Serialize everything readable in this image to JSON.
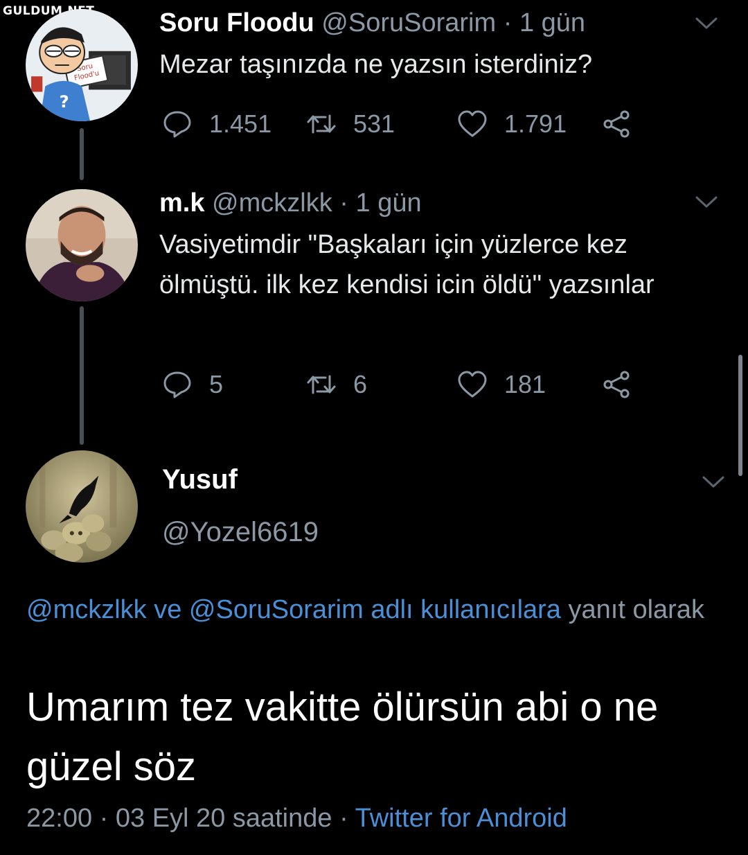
{
  "watermark": "GULDUM.NET",
  "tweets": [
    {
      "name": "Soru Floodu",
      "handle": "@SoruSorarim",
      "separator": "·",
      "time": "1 gün",
      "text": "Mezar taşınızda ne yazsın isterdiniz?",
      "replies": "1.451",
      "retweets": "531",
      "likes": "1.791",
      "avatar_text": "Soru Flood'u"
    },
    {
      "name": "m.k",
      "handle": "@mckzlkk",
      "separator": "·",
      "time": "1 gün",
      "text": "Vasiyetimdir \"Başkaları için yüzlerce kez ölmüştü. ilk kez kendisi icin öldü\" yazsınlar",
      "replies": "5",
      "retweets": "6",
      "likes": "181"
    }
  ],
  "focused_tweet": {
    "name": "Yusuf",
    "handle": "@Yozel6619",
    "reply_to": {
      "link_text": "@mckzlkk ve @SoruSorarim adlı kullanıcılara",
      "suffix": "yanıt olarak"
    },
    "text": "Umarım tez vakitte ölürsün abi o ne güzel söz",
    "timestamp": "22:00 · 03 Eyl 20 saatinde",
    "meta_separator": "·",
    "source": "Twitter for Android"
  },
  "icons": {
    "reply": "speech-bubble-icon",
    "retweet": "retweet-icon",
    "like": "heart-icon",
    "share": "share-icon",
    "more": "chevron-down-icon"
  },
  "colors": {
    "background": "#000000",
    "text": "#e7e9ea",
    "secondary": "#8b98a5",
    "link": "#4b8fd6",
    "thread_line": "#4a4f55"
  }
}
